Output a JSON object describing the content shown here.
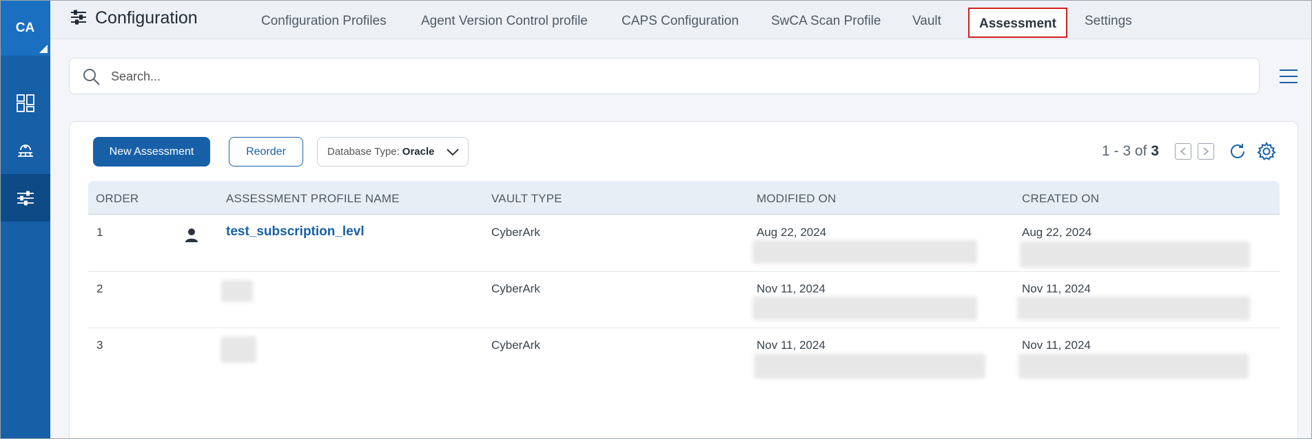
{
  "rail": {
    "brand": "CA",
    "items": [
      {
        "icon": "dashboard-icon"
      },
      {
        "icon": "cloud-network-icon"
      },
      {
        "icon": "sliders-icon",
        "active": true
      }
    ]
  },
  "header": {
    "title": "Configuration",
    "tabs": [
      {
        "label": "Configuration Profiles"
      },
      {
        "label": "Agent Version Control profile"
      },
      {
        "label": "CAPS Configuration"
      },
      {
        "label": "SwCA Scan Profile"
      },
      {
        "label": "Vault"
      },
      {
        "label": "Assessment",
        "active": true
      },
      {
        "label": "Settings"
      }
    ]
  },
  "search": {
    "placeholder": "Search..."
  },
  "toolbar": {
    "new_label": "New Assessment",
    "reorder_label": "Reorder",
    "filter_prefix": "Database Type:",
    "filter_value": "Oracle"
  },
  "pager": {
    "range": "1 - 3 of",
    "total": "3"
  },
  "table": {
    "columns": [
      "ORDER",
      "ASSESSMENT PROFILE NAME",
      "VAULT TYPE",
      "MODIFIED ON",
      "CREATED ON"
    ],
    "rows": [
      {
        "order": "1",
        "name": "test_subscription_levl",
        "vault": "CyberArk",
        "modified": "Aug 22, 2024",
        "created": "Aug 22, 2024"
      },
      {
        "order": "2",
        "name": "",
        "vault": "CyberArk",
        "modified": "Nov 11, 2024",
        "created": "Nov 11, 2024"
      },
      {
        "order": "3",
        "name": "",
        "vault": "CyberArk",
        "modified": "Nov 11, 2024",
        "created": "Nov 11, 2024"
      }
    ]
  },
  "colors": {
    "primary": "#1760a8",
    "rail": "#1760a8",
    "rail_active": "#0d4a86",
    "highlight_border": "#d0201e"
  }
}
